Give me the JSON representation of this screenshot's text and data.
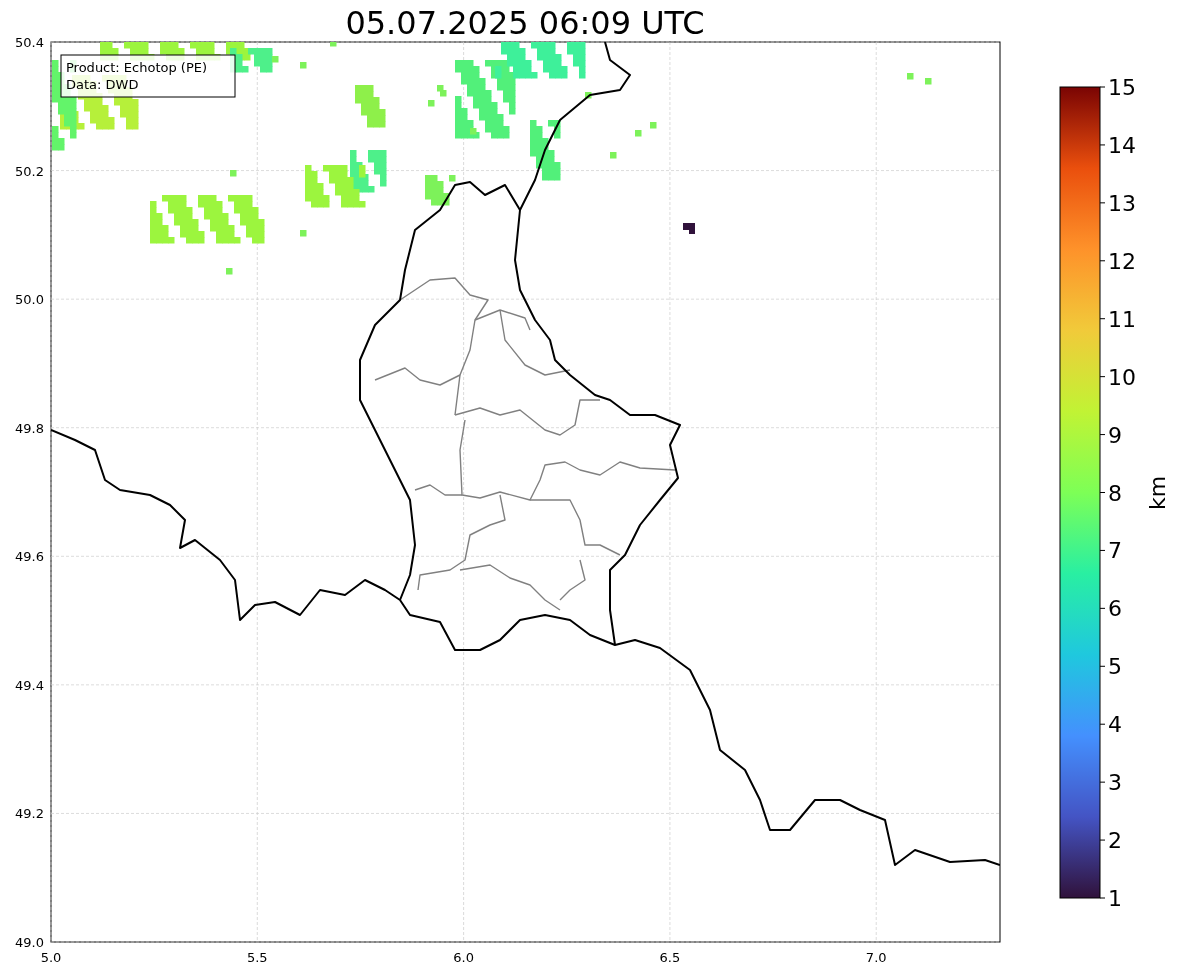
{
  "title": "05.07.2025 06:09 UTC",
  "annotation": [
    "Product: Echotop (PE)",
    "Data: DWD"
  ],
  "x_ticks": [
    "5.0",
    "5.5",
    "6.0",
    "6.5",
    "7.0"
  ],
  "y_ticks": [
    "50.4",
    "50.2",
    "50.0",
    "49.8",
    "49.6",
    "49.4",
    "49.2",
    "49.0"
  ],
  "colorbar": {
    "label": "km",
    "ticks": [
      "15",
      "14",
      "13",
      "12",
      "11",
      "10",
      "9",
      "8",
      "7",
      "6",
      "5",
      "4",
      "3",
      "2",
      "1"
    ]
  }
}
